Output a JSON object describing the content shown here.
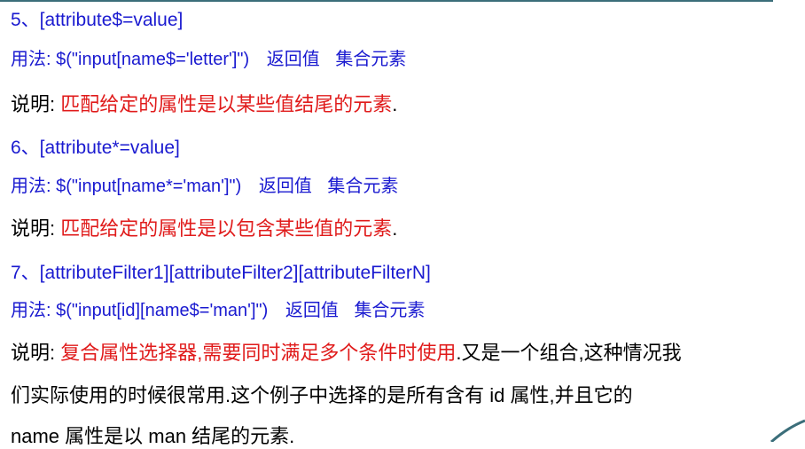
{
  "items": [
    {
      "heading": "5、[attribute$=value]",
      "usage_label": "用法:",
      "usage_code": "$(\"input[name$='letter']\")",
      "usage_return": "返回值",
      "usage_type": "集合元素",
      "desc_label": "说明:",
      "desc_text": "匹配给定的属性是以某些值结尾的元素",
      "desc_end": "."
    },
    {
      "heading": "6、[attribute*=value]",
      "usage_label": "用法:",
      "usage_code": "$(\"input[name*='man']\")",
      "usage_return": "返回值",
      "usage_type": "集合元素",
      "desc_label": "说明:",
      "desc_text": "匹配给定的属性是以包含某些值的元素",
      "desc_end": "."
    },
    {
      "heading": "7、[attributeFilter1][attributeFilter2][attributeFilterN]",
      "usage_label": "用法:",
      "usage_code": "$(\"input[id][name$='man']\")",
      "usage_return": "返回值",
      "usage_type": "集合元素",
      "desc_label": "说明:",
      "desc_text": "复合属性选择器,需要同时满足多个条件时使用",
      "desc_end": ".又是一个组合,这种情况我",
      "desc_line2": "们实际使用的时候很常用.这个例子中选择的是所有含有 id 属性,并且它的",
      "desc_line3": "name 属性是以 man 结尾的元素."
    }
  ],
  "colors": {
    "heading": "#1a1ad0",
    "highlight": "#e01b1b",
    "rule": "#3b6e7a"
  }
}
